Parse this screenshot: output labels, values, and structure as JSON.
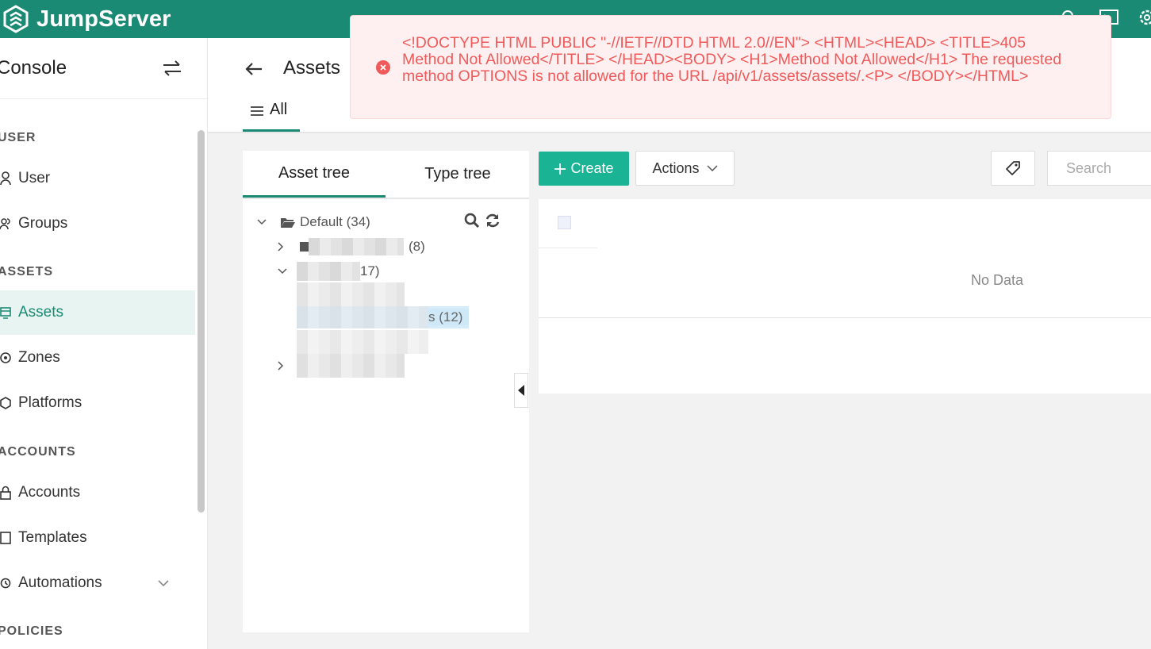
{
  "app": {
    "brand": "JumpServer",
    "accent": "#1a8a74",
    "primary_button": "#1ab394",
    "error_color": "#f05a5a"
  },
  "sidebar": {
    "title": "Console",
    "groups": [
      {
        "label": "USER",
        "items": [
          {
            "label": "User",
            "icon": "user-icon"
          },
          {
            "label": "Groups",
            "icon": "groups-icon"
          }
        ]
      },
      {
        "label": "ASSETS",
        "items": [
          {
            "label": "Assets",
            "icon": "assets-icon",
            "active": true
          },
          {
            "label": "Zones",
            "icon": "zones-icon"
          },
          {
            "label": "Platforms",
            "icon": "platforms-icon"
          }
        ]
      },
      {
        "label": "ACCOUNTS",
        "items": [
          {
            "label": "Accounts",
            "icon": "lock-icon"
          },
          {
            "label": "Templates",
            "icon": "templates-icon"
          },
          {
            "label": "Automations",
            "icon": "automations-icon"
          }
        ]
      },
      {
        "label": "POLICIES",
        "items": []
      }
    ]
  },
  "page": {
    "title": "Assets",
    "tabs": [
      {
        "label": "All"
      }
    ]
  },
  "tree": {
    "tabs": [
      {
        "label": "Asset tree"
      },
      {
        "label": "Type tree"
      }
    ],
    "root": {
      "label": "Default (34)"
    },
    "nodes": [
      {
        "count": "(8)"
      },
      {
        "count": "17)"
      },
      {
        "count": "s (12)"
      }
    ]
  },
  "toolbar": {
    "create_label": "Create",
    "actions_label": "Actions",
    "search_placeholder": "Search"
  },
  "table": {
    "empty_text": "No Data"
  },
  "toast": {
    "message": "<!DOCTYPE HTML PUBLIC \"-//IETF//DTD HTML 2.0//EN\"> <HTML><HEAD> <TITLE>405 Method Not Allowed</TITLE> </HEAD><BODY> <H1>Method Not Allowed</H1> The requested method OPTIONS is not allowed for the URL /api/v1/assets/assets/.<P> </BODY></HTML>"
  }
}
